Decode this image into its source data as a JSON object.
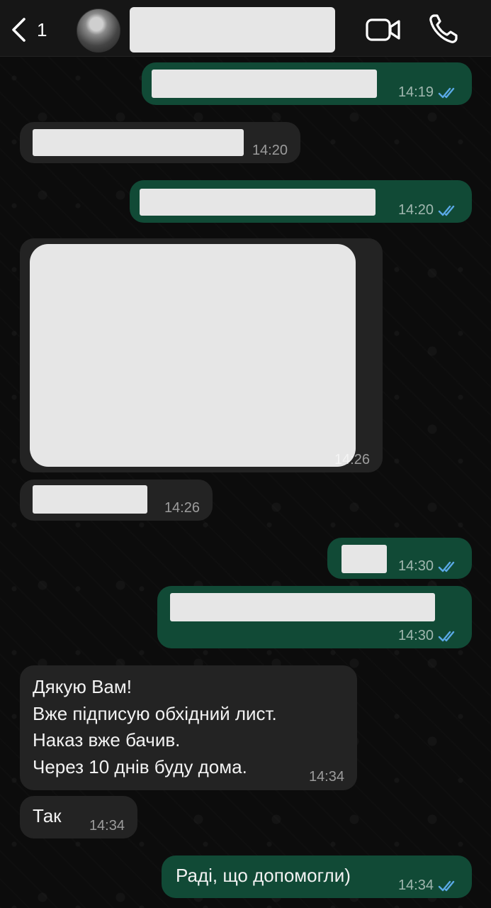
{
  "header": {
    "back_count": "1",
    "contact_name": "",
    "icons": {
      "back": "chevron-left-icon",
      "video": "video-camera-icon",
      "phone": "phone-icon"
    }
  },
  "colors": {
    "outgoing_bubble": "#114a36",
    "incoming_bubble": "#232323",
    "read_ticks": "#5aa9e6",
    "background": "#0c0c0c"
  },
  "messages": [
    {
      "direction": "out",
      "text": "",
      "time": "14:19",
      "status": "read"
    },
    {
      "direction": "in",
      "text": "",
      "time": "14:20"
    },
    {
      "direction": "out",
      "text": "",
      "time": "14:20",
      "status": "read"
    },
    {
      "direction": "in",
      "text": "",
      "time": "14:26",
      "kind": "media"
    },
    {
      "direction": "in",
      "text": "",
      "time": "14:26"
    },
    {
      "direction": "out",
      "text": "",
      "time": "14:30",
      "status": "read"
    },
    {
      "direction": "out",
      "text": "",
      "time": "14:30",
      "status": "read"
    },
    {
      "direction": "in",
      "text": "Дякую Вам!\nВже підписую обхідний лист.\nНаказ вже бачив.\nЧерез 10 днів буду дома.",
      "time": "14:34"
    },
    {
      "direction": "in",
      "text": "Так",
      "time": "14:34"
    },
    {
      "direction": "out",
      "text": "Раді, що допомогли)",
      "time": "14:34",
      "status": "read"
    }
  ]
}
